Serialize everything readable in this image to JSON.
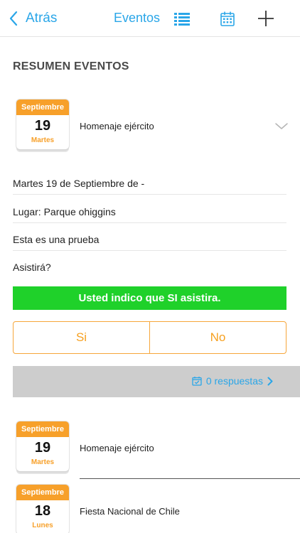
{
  "nav": {
    "back_label": "Atrás",
    "title": "Eventos"
  },
  "section_title": "RESUMEN EVENTOS",
  "selected_event": {
    "month": "Septiembre",
    "day": "19",
    "weekday": "Martes",
    "title": "Homenaje ejército",
    "date_text": "Martes 19 de Septiembre de -",
    "place_text": "Lugar: Parque ohiggins",
    "description": "Esta es una prueba",
    "question": "Asistirá?",
    "status_banner": "Usted indico que SI asistira.",
    "yes_label": "Si",
    "no_label": "No",
    "responses_label": "0 respuestas"
  },
  "event_list": [
    {
      "month": "Septiembre",
      "day": "19",
      "weekday": "Martes",
      "title": "Homenaje ejército"
    },
    {
      "month": "Septiembre",
      "day": "18",
      "weekday": "Lunes",
      "title": "Fiesta Nacional de Chile"
    }
  ],
  "colors": {
    "accent_blue": "#2aa6e8",
    "calendar_orange": "#f7a02a",
    "confirm_green": "#1fd12a",
    "responses_bar_gray": "#cdcdcd"
  },
  "icons": [
    "chevron-left-icon",
    "list-icon",
    "calendar-icon",
    "plus-icon",
    "chevron-down-icon",
    "calendar-check-icon",
    "chevron-right-icon"
  ]
}
